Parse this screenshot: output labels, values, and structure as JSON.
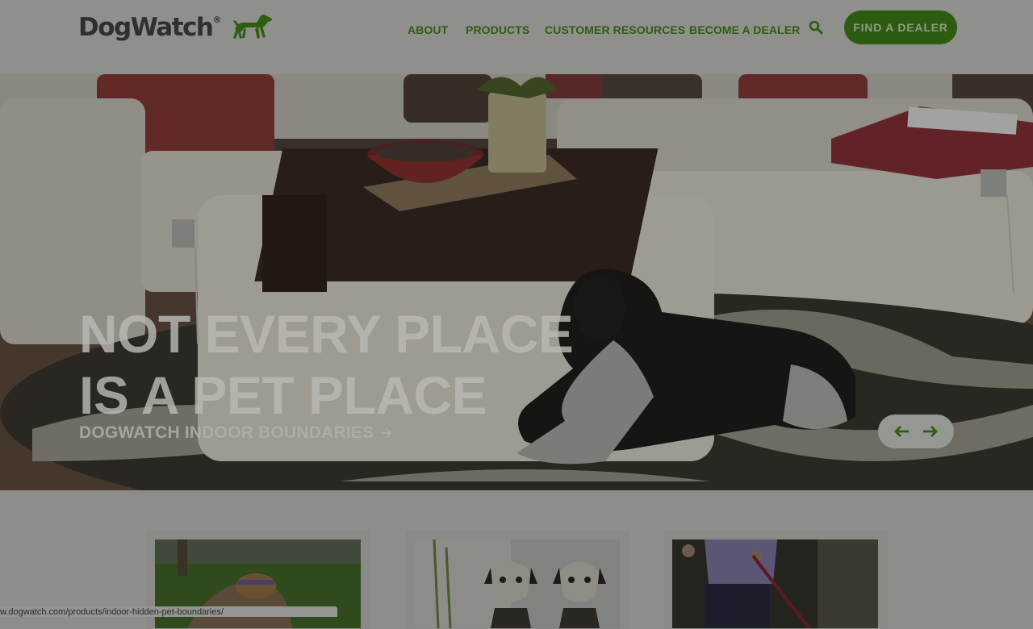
{
  "brand": {
    "name": "DogWatch",
    "mark": "®"
  },
  "nav": {
    "items": [
      {
        "label": "ABOUT"
      },
      {
        "label": "PRODUCTS"
      },
      {
        "label": "CUSTOMER RESOURCES"
      },
      {
        "label": "BECOME A DEALER"
      }
    ],
    "cta_label": "FIND A DEALER"
  },
  "hero": {
    "headline_line1": "NOT EVERY PLACE",
    "headline_line2": "IS A PET PLACE",
    "link_label": "DOGWATCH INDOOR BOUNDARIES"
  },
  "status_bar": {
    "url": "w.dogwatch.com/products/indoor-hidden-pet-boundaries/"
  },
  "colors": {
    "brand_green": "#2c5c0f",
    "nav_green": "#2f5c13",
    "overlay_gray": "#8f8f8b"
  },
  "icons": [
    "dog-logo-icon",
    "search-icon",
    "arrow-right-icon",
    "arrow-left-icon"
  ]
}
